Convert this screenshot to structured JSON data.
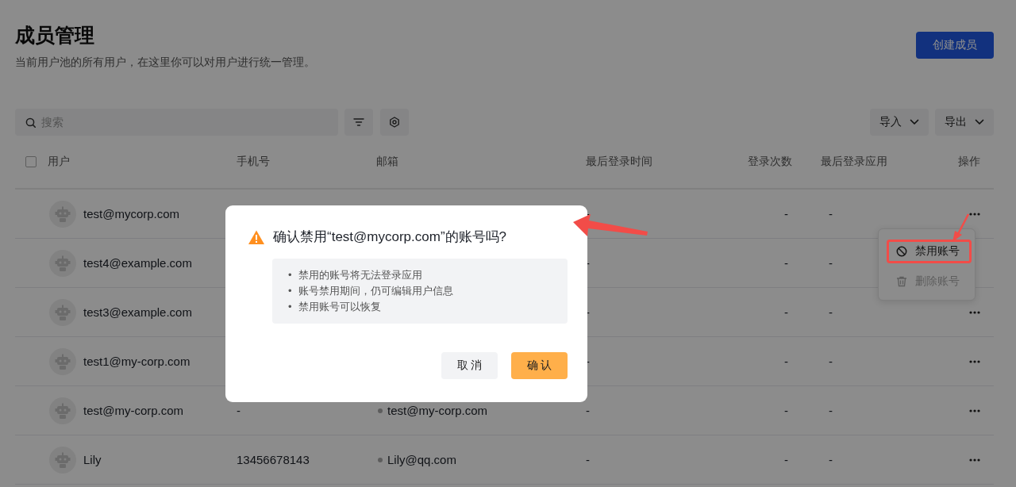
{
  "header": {
    "title": "成员管理",
    "subtitle": "当前用户池的所有用户，在这里你可以对用户进行统一管理。",
    "create_button": "创建成员"
  },
  "toolbar": {
    "search_placeholder": "搜索",
    "import_button": "导入",
    "export_button": "导出"
  },
  "table": {
    "select_all": {
      "checked": false
    },
    "columns": [
      "用户",
      "手机号",
      "邮箱",
      "最后登录时间",
      "登录次数",
      "最后登录应用",
      "操作"
    ],
    "rows": [
      {
        "user": "test@mycorp.com",
        "last_login": "-",
        "login_count": "-",
        "last_app": "-",
        "more": true
      },
      {
        "user": "test4@example.com",
        "last_login": "-",
        "login_count": "-",
        "last_app": "-",
        "more": false
      },
      {
        "user": "test3@example.com",
        "last_login": "-",
        "login_count": "-",
        "last_app": "-",
        "more": true
      },
      {
        "user": "test1@my-corp.com",
        "last_login": "-",
        "login_count": "-",
        "last_app": "-",
        "more": true
      },
      {
        "user": "test@my-corp.com",
        "phone": "-",
        "email": "test@my-corp.com",
        "last_login": "-",
        "login_count": "-",
        "last_app": "-",
        "more": true
      },
      {
        "user": "Lily",
        "phone": "13456678143",
        "email": "Lily@qq.com",
        "last_login": "-",
        "login_count": "-",
        "last_app": "-",
        "more": true
      }
    ]
  },
  "row_menu": {
    "items": [
      {
        "kind": "ban",
        "label": "禁用账号",
        "disabled": false,
        "highlighted": true
      },
      {
        "kind": "trash",
        "label": "删除账号",
        "disabled": true,
        "highlighted": false
      }
    ]
  },
  "dialog": {
    "title": "确认禁用“test@mycorp.com”的账号吗?",
    "notes": [
      {
        "marker": "•",
        "text": "禁用的账号将无法登录应用"
      },
      {
        "marker": "•",
        "text": "账号禁用期间，仍可编辑用户信息"
      },
      {
        "marker": "•",
        "text": "禁用账号可以恢复"
      }
    ],
    "cancel_button": "取 消",
    "confirm_button": "确 认"
  },
  "annotations": [
    {
      "kind": "arrow"
    },
    {
      "kind": "arrow"
    }
  ]
}
